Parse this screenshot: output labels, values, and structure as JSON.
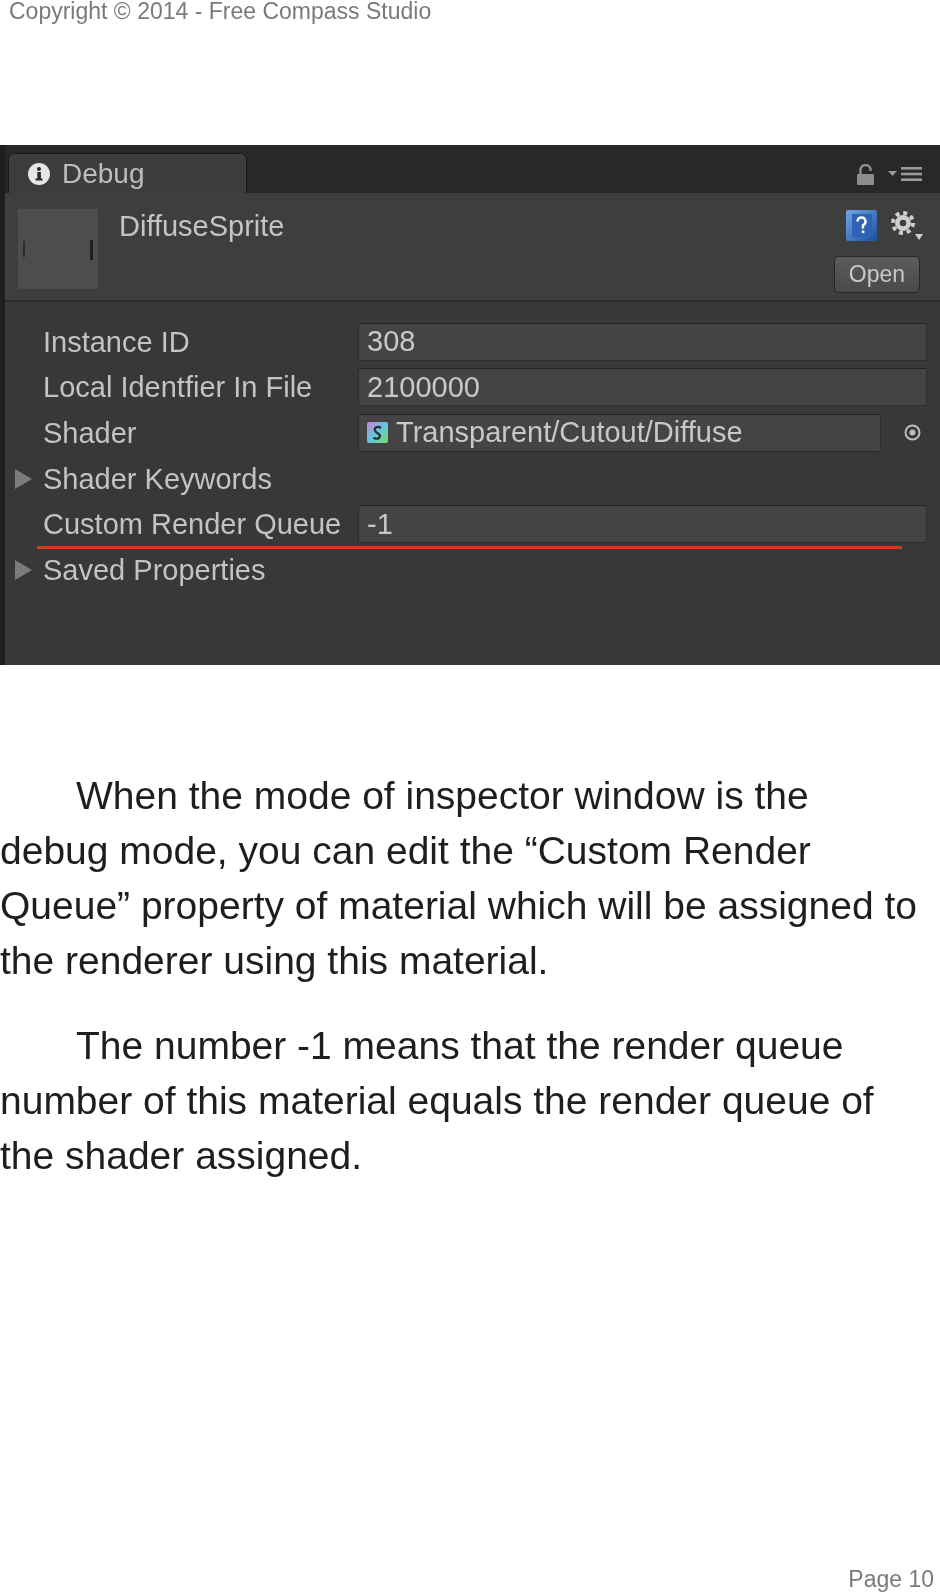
{
  "header": {
    "copyright": "Copyright © 2014 - Free Compass Studio"
  },
  "inspector": {
    "tabs": [
      {
        "label": "Debug",
        "selected": true
      }
    ],
    "asset": {
      "name": "DiffuseSprite",
      "button": "Open"
    },
    "properties": [
      {
        "kind": "field",
        "label": "Instance ID",
        "value": "308",
        "highlighted": false
      },
      {
        "kind": "field",
        "label": "Local Identfier In File",
        "value": "2100000",
        "highlighted": false
      },
      {
        "kind": "object",
        "label": "Shader",
        "value": "Transparent/Cutout/Diffuse",
        "highlighted": false
      },
      {
        "kind": "foldout",
        "label": "Shader Keywords",
        "expanded": false,
        "highlighted": false
      },
      {
        "kind": "field",
        "label": "Custom Render Queue",
        "value": "-1",
        "highlighted": true
      },
      {
        "kind": "foldout",
        "label": "Saved Properties",
        "expanded": false,
        "highlighted": false
      }
    ]
  },
  "paragraphs": [
    "When the mode of inspector window is the debug mode, you can edit the “Custom Render Queue” property of material which will be assigned to the renderer using this material.",
    "The number -1 means that the render queue number of this material equals the render queue of the shader assigned."
  ],
  "footer": {
    "page": "Page 10"
  }
}
